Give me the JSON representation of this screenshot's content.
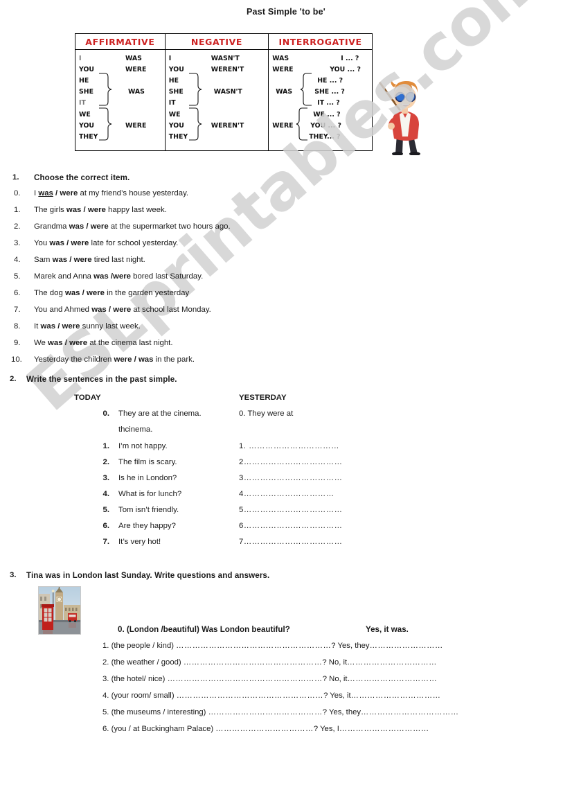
{
  "document": {
    "title": "Past Simple 'to be'",
    "watermark": "ESLprintables.com"
  },
  "grammar_table": {
    "headers": [
      "AFFIRMATIVE",
      "NEGATIVE",
      "INTERROGATIVE"
    ],
    "header_color": "#cc2222",
    "affirmative": {
      "pronouns": [
        "I",
        "YOU",
        "HE",
        "SHE",
        "IT",
        "WE",
        "YOU",
        "THEY"
      ],
      "verbs": [
        "WAS",
        "WERE",
        "WAS",
        "WERE"
      ],
      "verb_i": "WAS",
      "verb_you": "WERE",
      "verb_group1": "WAS",
      "verb_group2": "WERE"
    },
    "negative": {
      "pronouns": [
        "I",
        "YOU",
        "HE",
        "SHE",
        "IT",
        "WE",
        "YOU",
        "THEY"
      ],
      "verb_i": "WASN'T",
      "verb_you": "WEREN'T",
      "verb_group1": "WASN'T",
      "verb_group2": "WEREN'T"
    },
    "interrogative": {
      "verb_i": "WAS",
      "verb_you": "WERE",
      "verb_group1": "WAS",
      "verb_group2": "WERE",
      "subjects": [
        "I ... ?",
        "YOU  ... ?",
        "HE  ... ?",
        "SHE ... ?",
        "IT  ... ?",
        "WE  ... ?",
        "YOU ... ?",
        "THEY... ?"
      ]
    }
  },
  "exercise1": {
    "number": "1.",
    "heading": "Choose the correct item.",
    "items": [
      {
        "num": "0.",
        "before": "I ",
        "choice_a": "was",
        "sep": " / ",
        "choice_b": "were",
        "after": " at my friend’s house yesterday.",
        "answer_underlined": "was"
      },
      {
        "num": "1.",
        "before": "The girls ",
        "choice_a": "was",
        "sep": " / ",
        "choice_b": "were",
        "after": " happy last week.",
        "answer_underlined": ""
      },
      {
        "num": "2.",
        "before": "Grandma ",
        "choice_a": "was",
        "sep": " / ",
        "choice_b": "were",
        "after": " at the supermarket two hours ago.",
        "answer_underlined": ""
      },
      {
        "num": "3.",
        "before": "You ",
        "choice_a": "was",
        "sep": " / ",
        "choice_b": "were",
        "after": " late for school yesterday.",
        "answer_underlined": ""
      },
      {
        "num": "4.",
        "before": "Sam ",
        "choice_a": "was",
        "sep": " / ",
        "choice_b": "were",
        "after": " tired last night.",
        "answer_underlined": ""
      },
      {
        "num": "5.",
        "before": "Marek and Anna ",
        "choice_a": "was",
        "sep": " /",
        "choice_b": "were",
        "after": " bored last Saturday.",
        "answer_underlined": ""
      },
      {
        "num": "6.",
        "before": "The dog ",
        "choice_a": "was",
        "sep": " / ",
        "choice_b": "were",
        "after": " in the garden yesterday",
        "answer_underlined": ""
      },
      {
        "num": "7.",
        "before": "You and Ahmed ",
        "choice_a": "was",
        "sep": " / ",
        "choice_b": "were",
        "after": " at school last Monday.",
        "answer_underlined": ""
      },
      {
        "num": "8.",
        "before": " It ",
        "choice_a": "was",
        "sep": " / ",
        "choice_b": "were",
        "after": " sunny last week.",
        "answer_underlined": ""
      },
      {
        "num": "9.",
        "before": "We ",
        "choice_a": "was",
        "sep": " / ",
        "choice_b": "were",
        "after": " at the cinema last night.",
        "answer_underlined": ""
      },
      {
        "num": "10.",
        "before": "Yesterday the children ",
        "choice_a": "were",
        "sep": " / ",
        "choice_b": "was",
        "after": " in the park.",
        "answer_underlined": ""
      }
    ]
  },
  "exercise2": {
    "number": "2.",
    "heading": "Write the sentences in the past simple.",
    "col_today": "TODAY",
    "col_yesterday": "YESTERDAY",
    "rows": [
      {
        "num": "0.",
        "today": "They are at the cinema.",
        "today_line2": "thcinema.",
        "yesterday": "0. They were at"
      },
      {
        "num": "1.",
        "today": "I’m not happy.",
        "today_line2": "",
        "yesterday": "1. ……………………………"
      },
      {
        "num": "2.",
        "today": "The film is scary.",
        "today_line2": "",
        "yesterday": "2………………………………"
      },
      {
        "num": "3.",
        "today": "Is he in London?",
        "today_line2": "",
        "yesterday": "3………………………………"
      },
      {
        "num": "4.",
        "today": "What is for lunch?",
        "today_line2": "",
        "yesterday": "4……………………………"
      },
      {
        "num": "5.",
        "today": "Tom isn’t friendly.",
        "today_line2": "",
        "yesterday": "5………………………………"
      },
      {
        "num": "6.",
        "today": "Are they happy?",
        "today_line2": "",
        "yesterday": "6………………………………"
      },
      {
        "num": "7.",
        "today": "It’s very hot!",
        "today_line2": "",
        "yesterday": "7………………………………"
      }
    ]
  },
  "exercise3": {
    "number": "3.",
    "heading": "Tina was in London last Sunday. Write questions and answers.",
    "photo_alt": "london-big-ben-phone-box",
    "example": {
      "question": "0. (London /beautiful) Was London beautiful?",
      "answer": "Yes, it was."
    },
    "items": [
      {
        "num": "1.",
        "prompt": "(the people / kind)",
        "dots": "…………………………………………………",
        "qmark": "?",
        "answer": "Yes, they",
        "answer_dots": "………………………"
      },
      {
        "num": "2.",
        "prompt": "(the weather / good)",
        "dots": "……………………………………………",
        "qmark": "?",
        "answer": "No, it",
        "answer_dots": "……………………………"
      },
      {
        "num": "3.",
        "prompt": "(the hotel/ nice)",
        "dots": "…………………………………………………",
        "qmark": "?",
        "answer": "No, it",
        "answer_dots": "……………………………"
      },
      {
        "num": "4.",
        "prompt": "(your room/ small)",
        "dots": "………………………………………………",
        "qmark": "?",
        "answer": " Yes, it",
        "answer_dots": "……………………………"
      },
      {
        "num": "5.",
        "prompt": "(the museums / interesting)",
        "dots": "……………………………………",
        "qmark": "?",
        "answer": "Yes, they",
        "answer_dots": "………………………………"
      },
      {
        "num": "6.",
        "prompt": "(you / at Buckingham Palace)",
        "dots": "………………………………",
        "qmark": "?",
        "answer": " Yes, I",
        "answer_dots": "……………………………"
      }
    ]
  }
}
